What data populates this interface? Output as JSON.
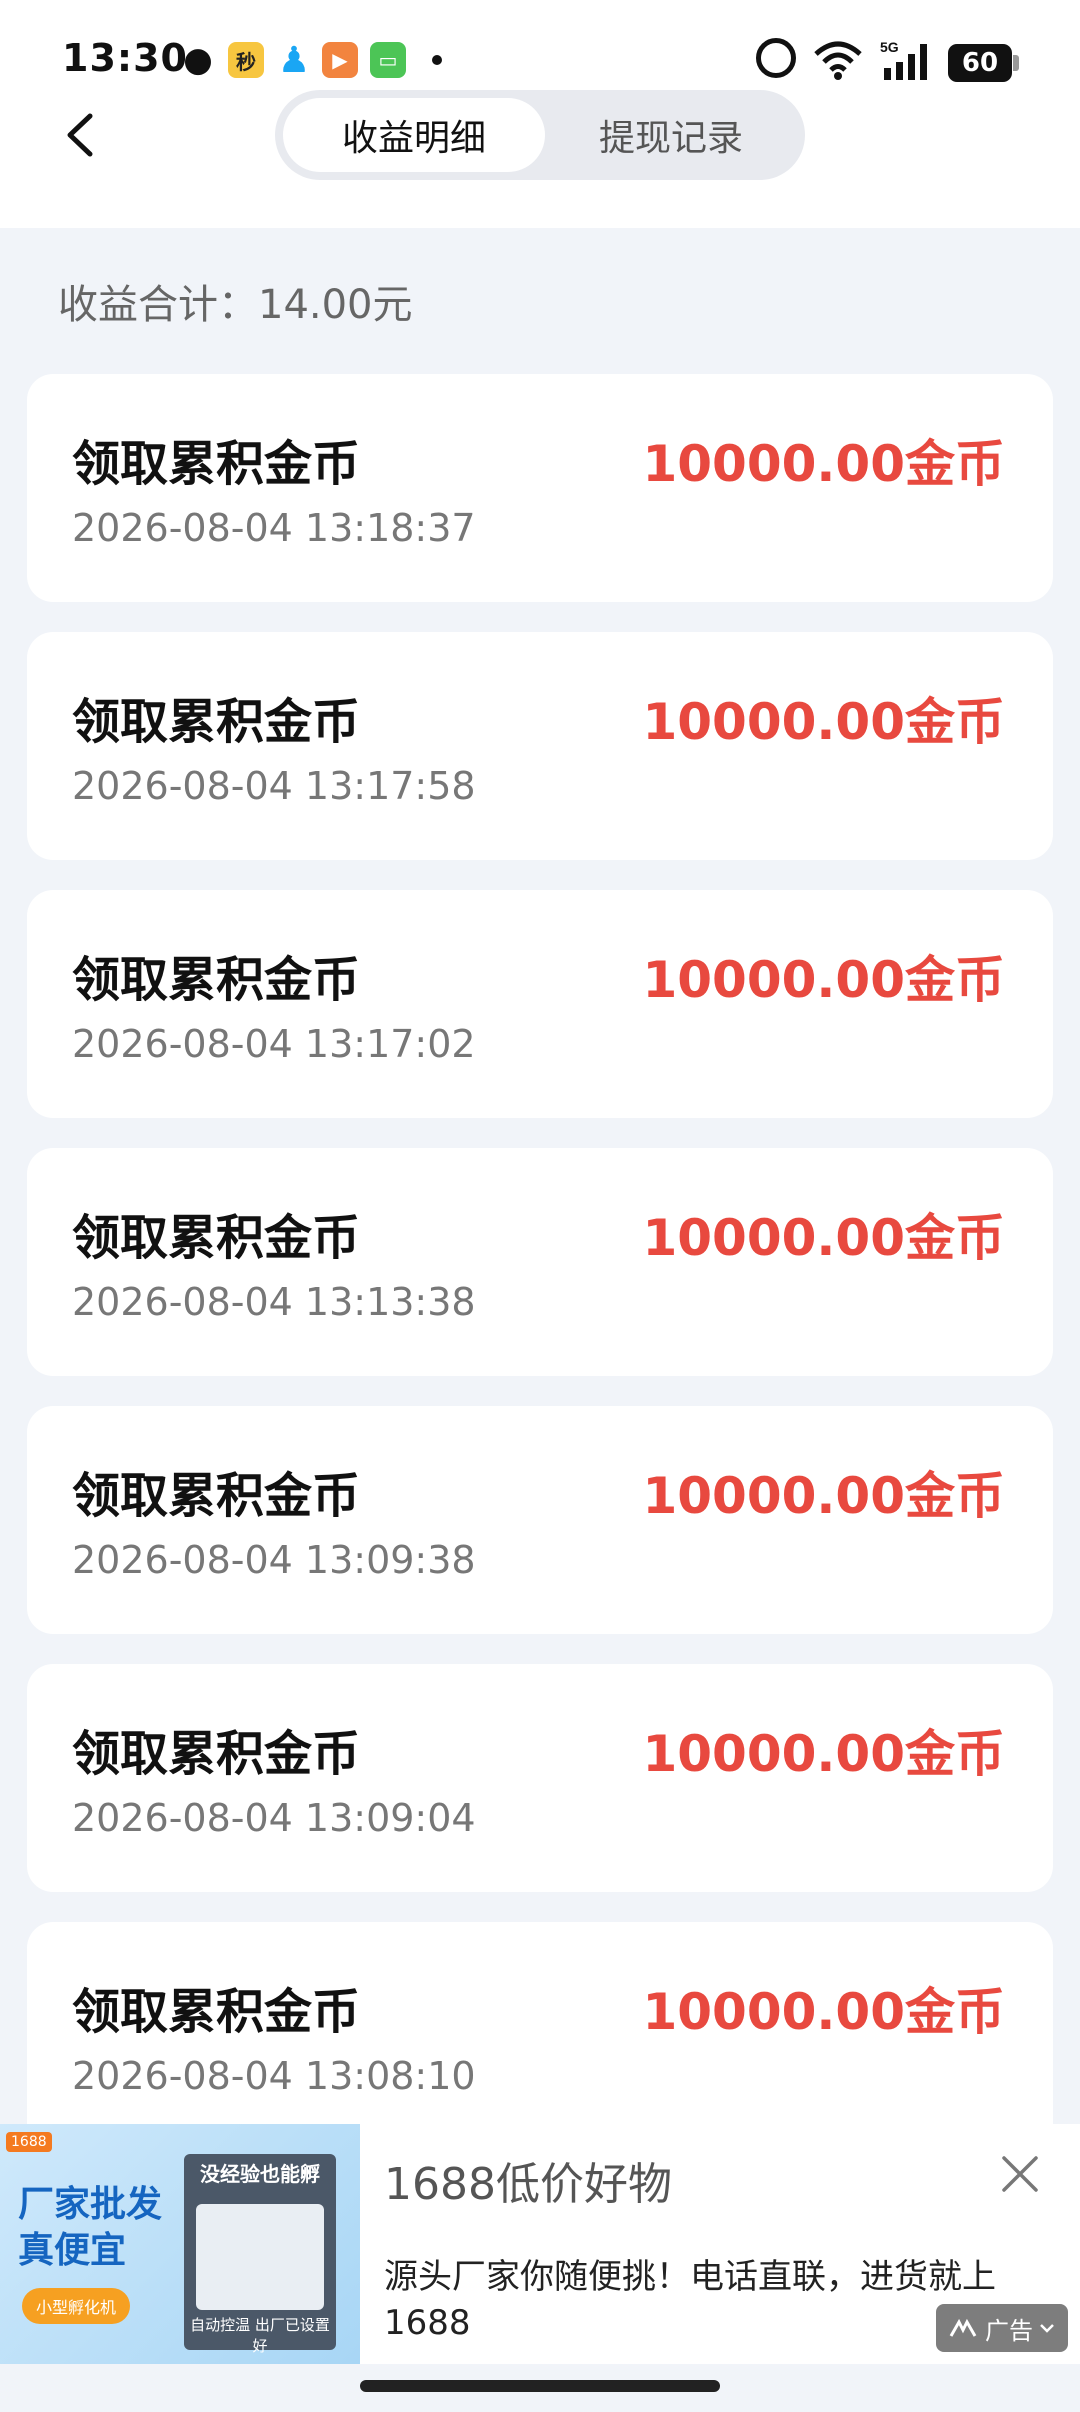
{
  "status_bar": {
    "time": "13:30",
    "battery": "60",
    "network": "5G",
    "noti_mi": "秒"
  },
  "header": {
    "tabs": [
      {
        "label": "收益明细",
        "active": true
      },
      {
        "label": "提现记录",
        "active": false
      }
    ]
  },
  "summary": {
    "total_label": "收益合计：14.00元"
  },
  "records": [
    {
      "title": "领取累积金币",
      "time": "2026-08-04 13:18:37",
      "amount": "10000.00金币"
    },
    {
      "title": "领取累积金币",
      "time": "2026-08-04 13:17:58",
      "amount": "10000.00金币"
    },
    {
      "title": "领取累积金币",
      "time": "2026-08-04 13:17:02",
      "amount": "10000.00金币"
    },
    {
      "title": "领取累积金币",
      "time": "2026-08-04 13:13:38",
      "amount": "10000.00金币"
    },
    {
      "title": "领取累积金币",
      "time": "2026-08-04 13:09:38",
      "amount": "10000.00金币"
    },
    {
      "title": "领取累积金币",
      "time": "2026-08-04 13:09:04",
      "amount": "10000.00金币"
    },
    {
      "title": "领取累积金币",
      "time": "2026-08-04 13:08:10",
      "amount": "10000.00金币"
    }
  ],
  "ad": {
    "title": "1688低价好物",
    "description": "源头厂家你随便挑！电话直联，进货就上1688",
    "badge": "广告",
    "image_logo": "1688",
    "image_headline_1": "厂家批发",
    "image_headline_2": "真便宜",
    "image_pill": "小型孵化机",
    "image_box_top": "没经验也能孵",
    "image_box_bottom": "自动控温  出厂已设置好"
  },
  "colors": {
    "accent_red": "#e8493f",
    "page_bg": "#f1f4f9"
  }
}
